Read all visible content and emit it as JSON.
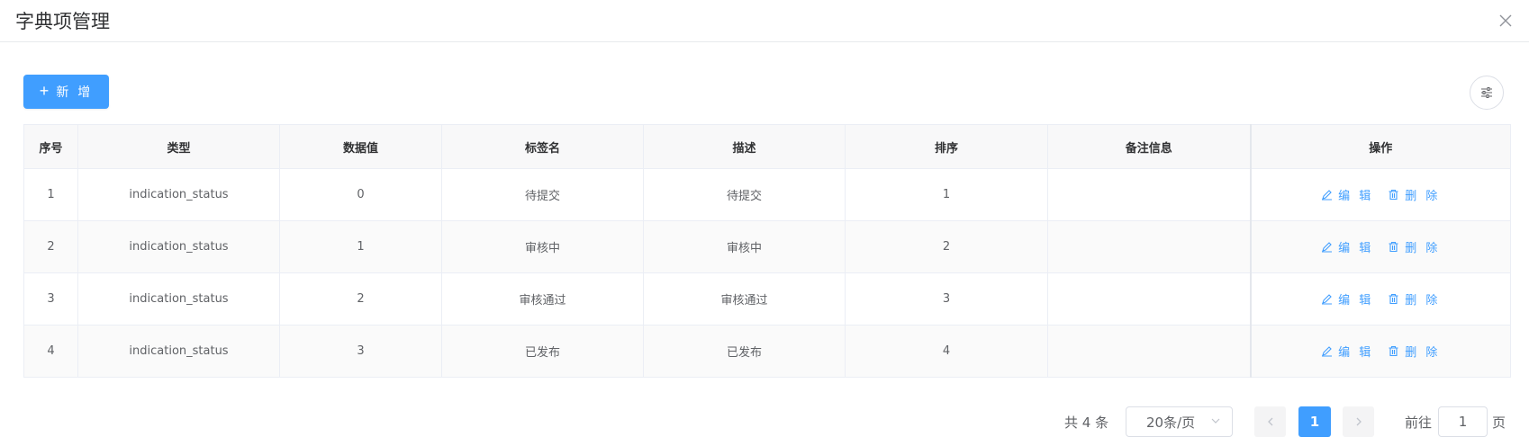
{
  "dialog": {
    "title": "字典项管理",
    "close_icon": "close-icon"
  },
  "toolbar": {
    "add_label": "新 增",
    "add_icon": "plus-icon",
    "settings_icon": "sliders-icon"
  },
  "colors": {
    "primary": "#409eff",
    "header_bg": "#f8f8f9",
    "border": "#ebeef5"
  },
  "table": {
    "headers": [
      "序号",
      "类型",
      "数据值",
      "标签名",
      "描述",
      "排序",
      "备注信息",
      "操作"
    ],
    "rows": [
      [
        "1",
        "indication_status",
        "0",
        "待提交",
        "待提交",
        "1",
        ""
      ],
      [
        "2",
        "indication_status",
        "1",
        "审核中",
        "审核中",
        "2",
        ""
      ],
      [
        "3",
        "indication_status",
        "2",
        "审核通过",
        "审核通过",
        "3",
        ""
      ],
      [
        "4",
        "indication_status",
        "3",
        "已发布",
        "已发布",
        "4",
        ""
      ]
    ],
    "edit_label": "编 辑",
    "delete_label": "删 除",
    "edit_icon": "edit-icon",
    "delete_icon": "trash-icon"
  },
  "pagination": {
    "total_text": "共 4 条",
    "page_size": "20条/页",
    "current_page": "1",
    "goto_prefix": "前往",
    "goto_value": "1",
    "goto_suffix": "页"
  }
}
